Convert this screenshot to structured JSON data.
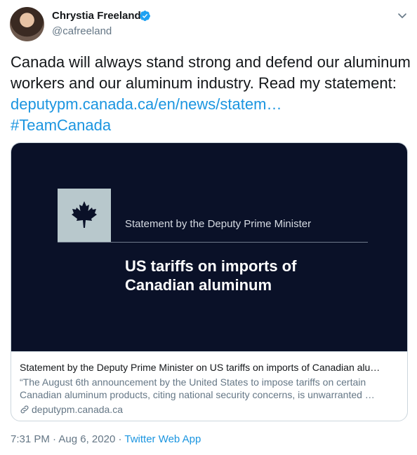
{
  "author": {
    "name": "Chrystia Freeland",
    "handle": "@cafreeland",
    "verified": true
  },
  "tweet": {
    "text_before_link": "Canada will always stand strong and defend our aluminum workers and our aluminum industry. Read my statement: ",
    "link": "deputypm.canada.ca/en/news/statem…",
    "hashtag": "#TeamCanada"
  },
  "card": {
    "image_subtitle": "Statement by the Deputy Prime Minister",
    "image_headline": "US tariffs on imports of Canadian aluminum",
    "title": "Statement by the Deputy Prime Minister on US tariffs on imports of Canadian alu…",
    "description": "“The August 6th announcement by the United States to impose tariffs on certain Canadian aluminum products, citing national security concerns, is unwarranted …",
    "domain": "deputypm.canada.ca"
  },
  "footer": {
    "time": "7:31 PM",
    "separator1": " · ",
    "date": "Aug 6, 2020",
    "separator2": " · ",
    "app": "Twitter Web App"
  },
  "colors": {
    "link": "#1b95e0",
    "verified": "#1da1f2",
    "card_bg": "#0a1128"
  },
  "icons": {
    "verified": "verified-badge-icon",
    "more": "chevron-down-icon",
    "link": "link-icon",
    "flag": "maple-leaf-icon"
  }
}
